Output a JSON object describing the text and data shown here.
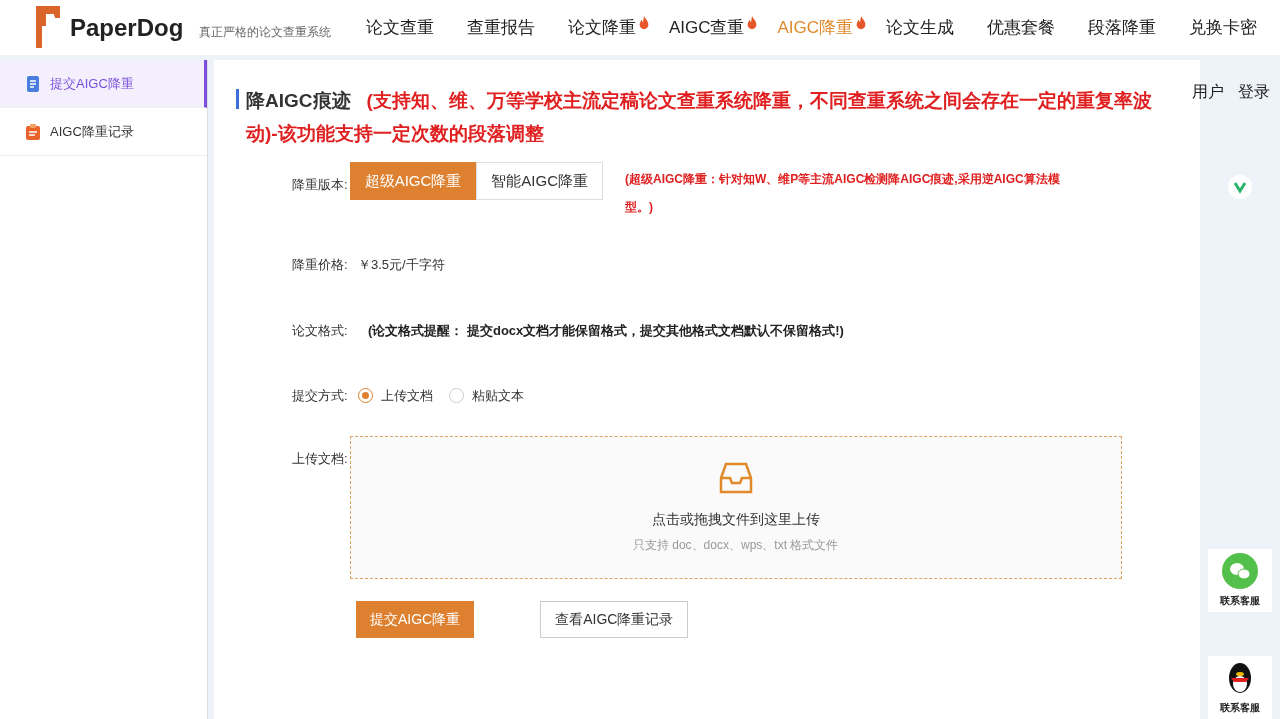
{
  "brand": {
    "name": "PaperDog",
    "slogan": "真正严格的论文查重系统"
  },
  "nav": [
    {
      "label": "论文查重",
      "selected": false,
      "hot": false
    },
    {
      "label": "查重报告",
      "selected": false,
      "hot": false
    },
    {
      "label": "论文降重",
      "selected": false,
      "hot": true
    },
    {
      "label": "AIGC查重",
      "selected": false,
      "hot": true
    },
    {
      "label": "AIGC降重",
      "selected": true,
      "hot": true
    },
    {
      "label": "论文生成",
      "selected": false,
      "hot": false
    },
    {
      "label": "优惠套餐",
      "selected": false,
      "hot": false
    },
    {
      "label": "段落降重",
      "selected": false,
      "hot": false
    },
    {
      "label": "兑换卡密",
      "selected": false,
      "hot": false
    }
  ],
  "sidebar": {
    "items": [
      {
        "label": "提交AIGC降重",
        "selected": true,
        "kind": "submit"
      },
      {
        "label": "AIGC降重记录",
        "selected": false,
        "kind": "record"
      }
    ]
  },
  "user_links": [
    "用户",
    "登录"
  ],
  "title": {
    "main": "降AIGC痕迹",
    "note": "(支持知、维、万等学校主流定稿论文查重系统降重，不同查重系统之间会存在一定的重复率波动)-该功能支持一定次数的段落调整"
  },
  "form": {
    "version": {
      "label": "降重版本:",
      "options": [
        {
          "label": "超级AIGC降重",
          "selected": true
        },
        {
          "label": "智能AIGC降重",
          "selected": false
        }
      ],
      "note": "(超级AIGC降重：针对知W、维P等主流AIGC检测降AIGC痕迹,采用逆AIGC算法模型。)"
    },
    "price": {
      "label": "降重价格:",
      "value": "￥3.5元/千字符"
    },
    "format": {
      "label": "论文格式:",
      "note": "(论文格式提醒： 提交docx文档才能保留格式，提交其他格式文档默认不保留格式!)"
    },
    "method": {
      "label": "提交方式:",
      "options": [
        {
          "label": "上传文档",
          "selected": true
        },
        {
          "label": "粘贴文本",
          "selected": false
        }
      ]
    },
    "upload": {
      "label": "上传文档:",
      "hint": "点击或拖拽文件到这里上传",
      "sub": "只支持 doc、docx、wps、txt 格式文件"
    },
    "buttons": [
      {
        "label": "提交AIGC降重",
        "kind": "primary"
      },
      {
        "label": "查看AIGC降重记录",
        "kind": "secondary"
      }
    ]
  },
  "side_contacts": [
    {
      "label": "联系客服",
      "kind": "wechat"
    },
    {
      "label": "联系客服",
      "kind": "qq"
    }
  ]
}
